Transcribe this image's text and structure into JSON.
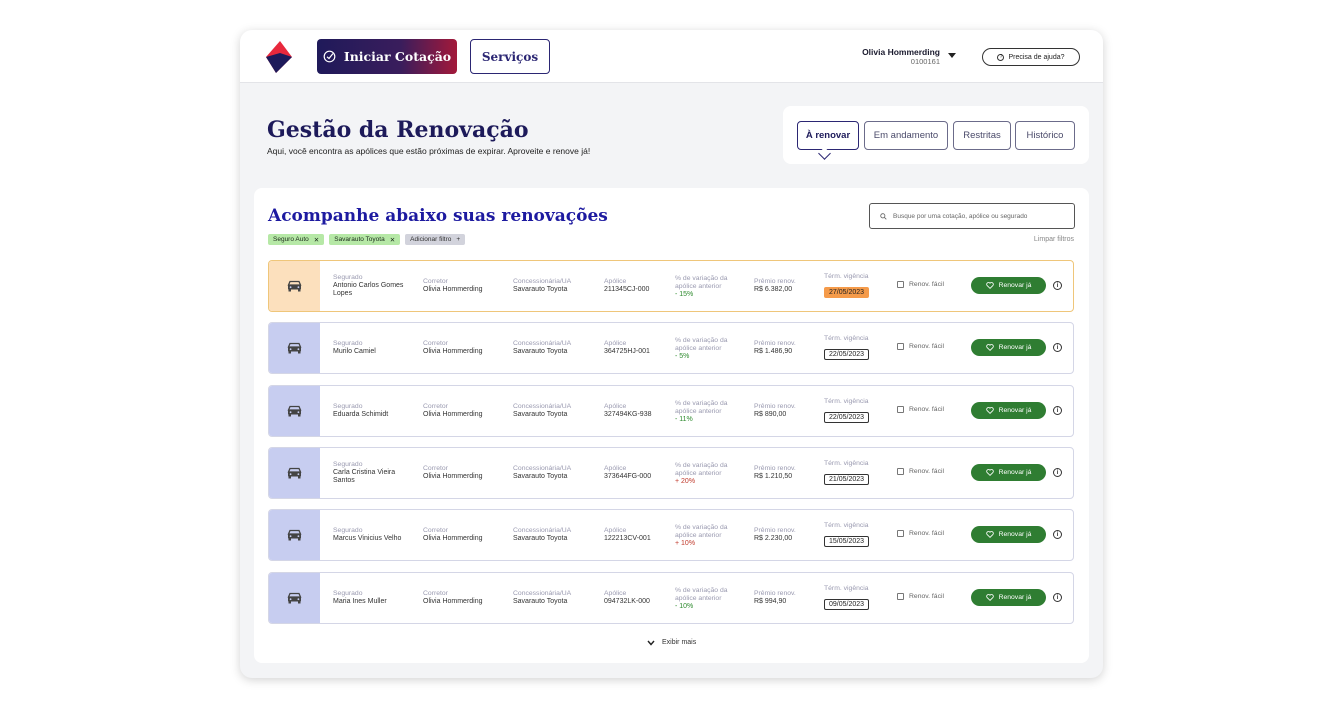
{
  "header": {
    "cotacao_label": "Iniciar Cotação",
    "servicos_label": "Serviços",
    "user_name": "Olivia Hommerding",
    "user_code": "0100161",
    "help_label": "Precisa de ajuda?"
  },
  "page": {
    "title": "Gestão da Renovação",
    "subtitle": "Aqui, você encontra as apólices que estão próximas de expirar. Aproveite e renove já!"
  },
  "tabs": [
    "À renovar",
    "Em andamento",
    "Restritas",
    "Histórico"
  ],
  "panel": {
    "title": "Acompanhe abaixo suas renovações",
    "search_placeholder": "Busque por uma cotação, apólice ou segurado",
    "clear_label": "Limpar filtros",
    "filters": [
      "Seguro Auto",
      "Savarauto Toyota"
    ],
    "add_filter_label": "Adicionar filtro",
    "show_more_label": "Exibir mais"
  },
  "columns": {
    "segurado": "Segurado",
    "corretor": "Corretor",
    "concessionaria": "Concessionária/UA",
    "apolice": "Apólice",
    "variacao": "% de variação da apólice anterior",
    "premio": "Prêmio renov.",
    "vigencia": "Térm. vigência",
    "renov_facil": "Renov. fácil",
    "renovar_btn": "Renovar já"
  },
  "rows": [
    {
      "segurado": "Antonio Carlos Gomes Lopes",
      "corretor": "Olivia Hommerding",
      "concessionaria": "Savarauto Toyota",
      "apolice": "211345CJ-000",
      "variacao": "- 15%",
      "premio": "R$ 6.382,00",
      "vigencia": "27/05/2023"
    },
    {
      "segurado": "Murilo Camiel",
      "corretor": "Olivia Hommerding",
      "concessionaria": "Savarauto Toyota",
      "apolice": "364725HJ-001",
      "variacao": "- 5%",
      "premio": "R$ 1.486,90",
      "vigencia": "22/05/2023"
    },
    {
      "segurado": "Eduarda Schimidt",
      "corretor": "Olivia Hommerding",
      "concessionaria": "Savarauto Toyota",
      "apolice": "327494KG-938",
      "variacao": "- 11%",
      "premio": "R$ 890,00",
      "vigencia": "22/05/2023"
    },
    {
      "segurado": "Carla Cristina Vieira Santos",
      "corretor": "Olivia Hommerding",
      "concessionaria": "Savarauto Toyota",
      "apolice": "373644FG-000",
      "variacao": "+ 20%",
      "premio": "R$ 1.210,50",
      "vigencia": "21/05/2023"
    },
    {
      "segurado": "Marcus Vinicius Velho",
      "corretor": "Olivia Hommerding",
      "concessionaria": "Savarauto Toyota",
      "apolice": "122213CV-001",
      "variacao": "+ 10%",
      "premio": "R$ 2.230,00",
      "vigencia": "15/05/2023"
    },
    {
      "segurado": "Maria Ines Muller",
      "corretor": "Olivia Hommerding",
      "concessionaria": "Savarauto Toyota",
      "apolice": "094732LK-000",
      "variacao": "- 10%",
      "premio": "R$ 994,90",
      "vigencia": "09/05/2023"
    }
  ],
  "colors": {
    "brand_navy": "#1d1a5a",
    "brand_red": "#e8283c",
    "renew_green": "#2f7d32",
    "highlight_orange": "#f59b4a"
  },
  "icons": [
    "brand-logo-icon",
    "add-quote-icon",
    "chevron-down-icon",
    "help-icon",
    "search-icon",
    "close-icon",
    "plus-icon",
    "car-icon",
    "heart-icon",
    "info-icon"
  ]
}
